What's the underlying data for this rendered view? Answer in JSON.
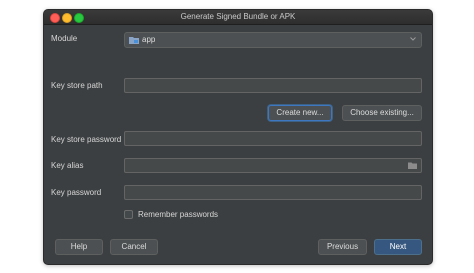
{
  "window": {
    "title": "Generate Signed Bundle or APK"
  },
  "module": {
    "label": "Module",
    "value": "app",
    "icon": "folder-module-icon"
  },
  "key_store_path": {
    "label": "Key store path",
    "value": ""
  },
  "buttons": {
    "create_new": "Create new...",
    "choose_existing": "Choose existing...",
    "help": "Help",
    "cancel": "Cancel",
    "previous": "Previous",
    "next": "Next"
  },
  "key_store_password": {
    "label": "Key store password",
    "value": ""
  },
  "key_alias": {
    "label": "Key alias",
    "value": ""
  },
  "key_password": {
    "label": "Key password",
    "value": ""
  },
  "remember": {
    "label": "Remember passwords",
    "checked": false
  },
  "colors": {
    "dialog_bg": "#3c3f41",
    "primary_button": "#365880",
    "focus_ring": "#3d77c2"
  }
}
